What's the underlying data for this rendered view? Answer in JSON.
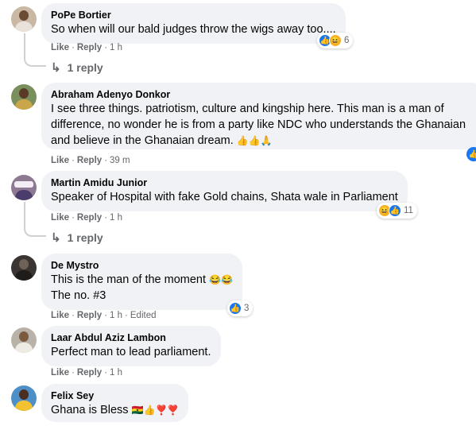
{
  "actions": {
    "like": "Like",
    "reply": "Reply",
    "edited": "Edited",
    "separator": "·"
  },
  "colors": {
    "like_blue": "#1877f2",
    "bubble_bg": "#f0f2f5",
    "meta_gray": "#65676b"
  },
  "comments": [
    {
      "author": "PoPe Bortier",
      "lines": [
        "So when will our bald judges throw the wigs away too...."
      ],
      "time": "1 h",
      "reactions": [
        "like",
        "haha"
      ],
      "reaction_count": "6",
      "replies": "1 reply",
      "avatar": "person-avatar"
    },
    {
      "author": "Abraham Adenyo Donkor",
      "lines": [
        "I see three things. patriotism, culture and kingship here. This man is a man of",
        "difference, no wonder he is from a party like NDC who understands the Ghanaian",
        "and believe in the Ghanaian dream."
      ],
      "emoji": "👍👍🙏",
      "time": "39 m",
      "avatar": "person-avatar"
    },
    {
      "author": "Martin Amidu Junior",
      "lines": [
        "Speaker of Hospital with fake Gold chains, Shata wale in Parliament"
      ],
      "time": "1 h",
      "reactions": [
        "haha",
        "like"
      ],
      "reaction_count": "11",
      "replies": "1 reply",
      "avatar": "crowd-avatar"
    },
    {
      "author": "De Mystro",
      "lines": [
        "This is the man of the moment",
        "The no. #3"
      ],
      "emoji": "😂😂",
      "time": "1 h",
      "edited": true,
      "reactions": [
        "like"
      ],
      "reaction_count": "3",
      "avatar": "dark-avatar"
    },
    {
      "author": "Laar Abdul Aziz Lambon",
      "lines": [
        "Perfect man to lead parliament."
      ],
      "time": "1 h",
      "avatar": "person-avatar"
    },
    {
      "author": "Felix Sey",
      "lines": [
        "Ghana is Bless"
      ],
      "emoji": "🇬🇭👍❣️❣️",
      "avatar": "person-avatar"
    }
  ]
}
